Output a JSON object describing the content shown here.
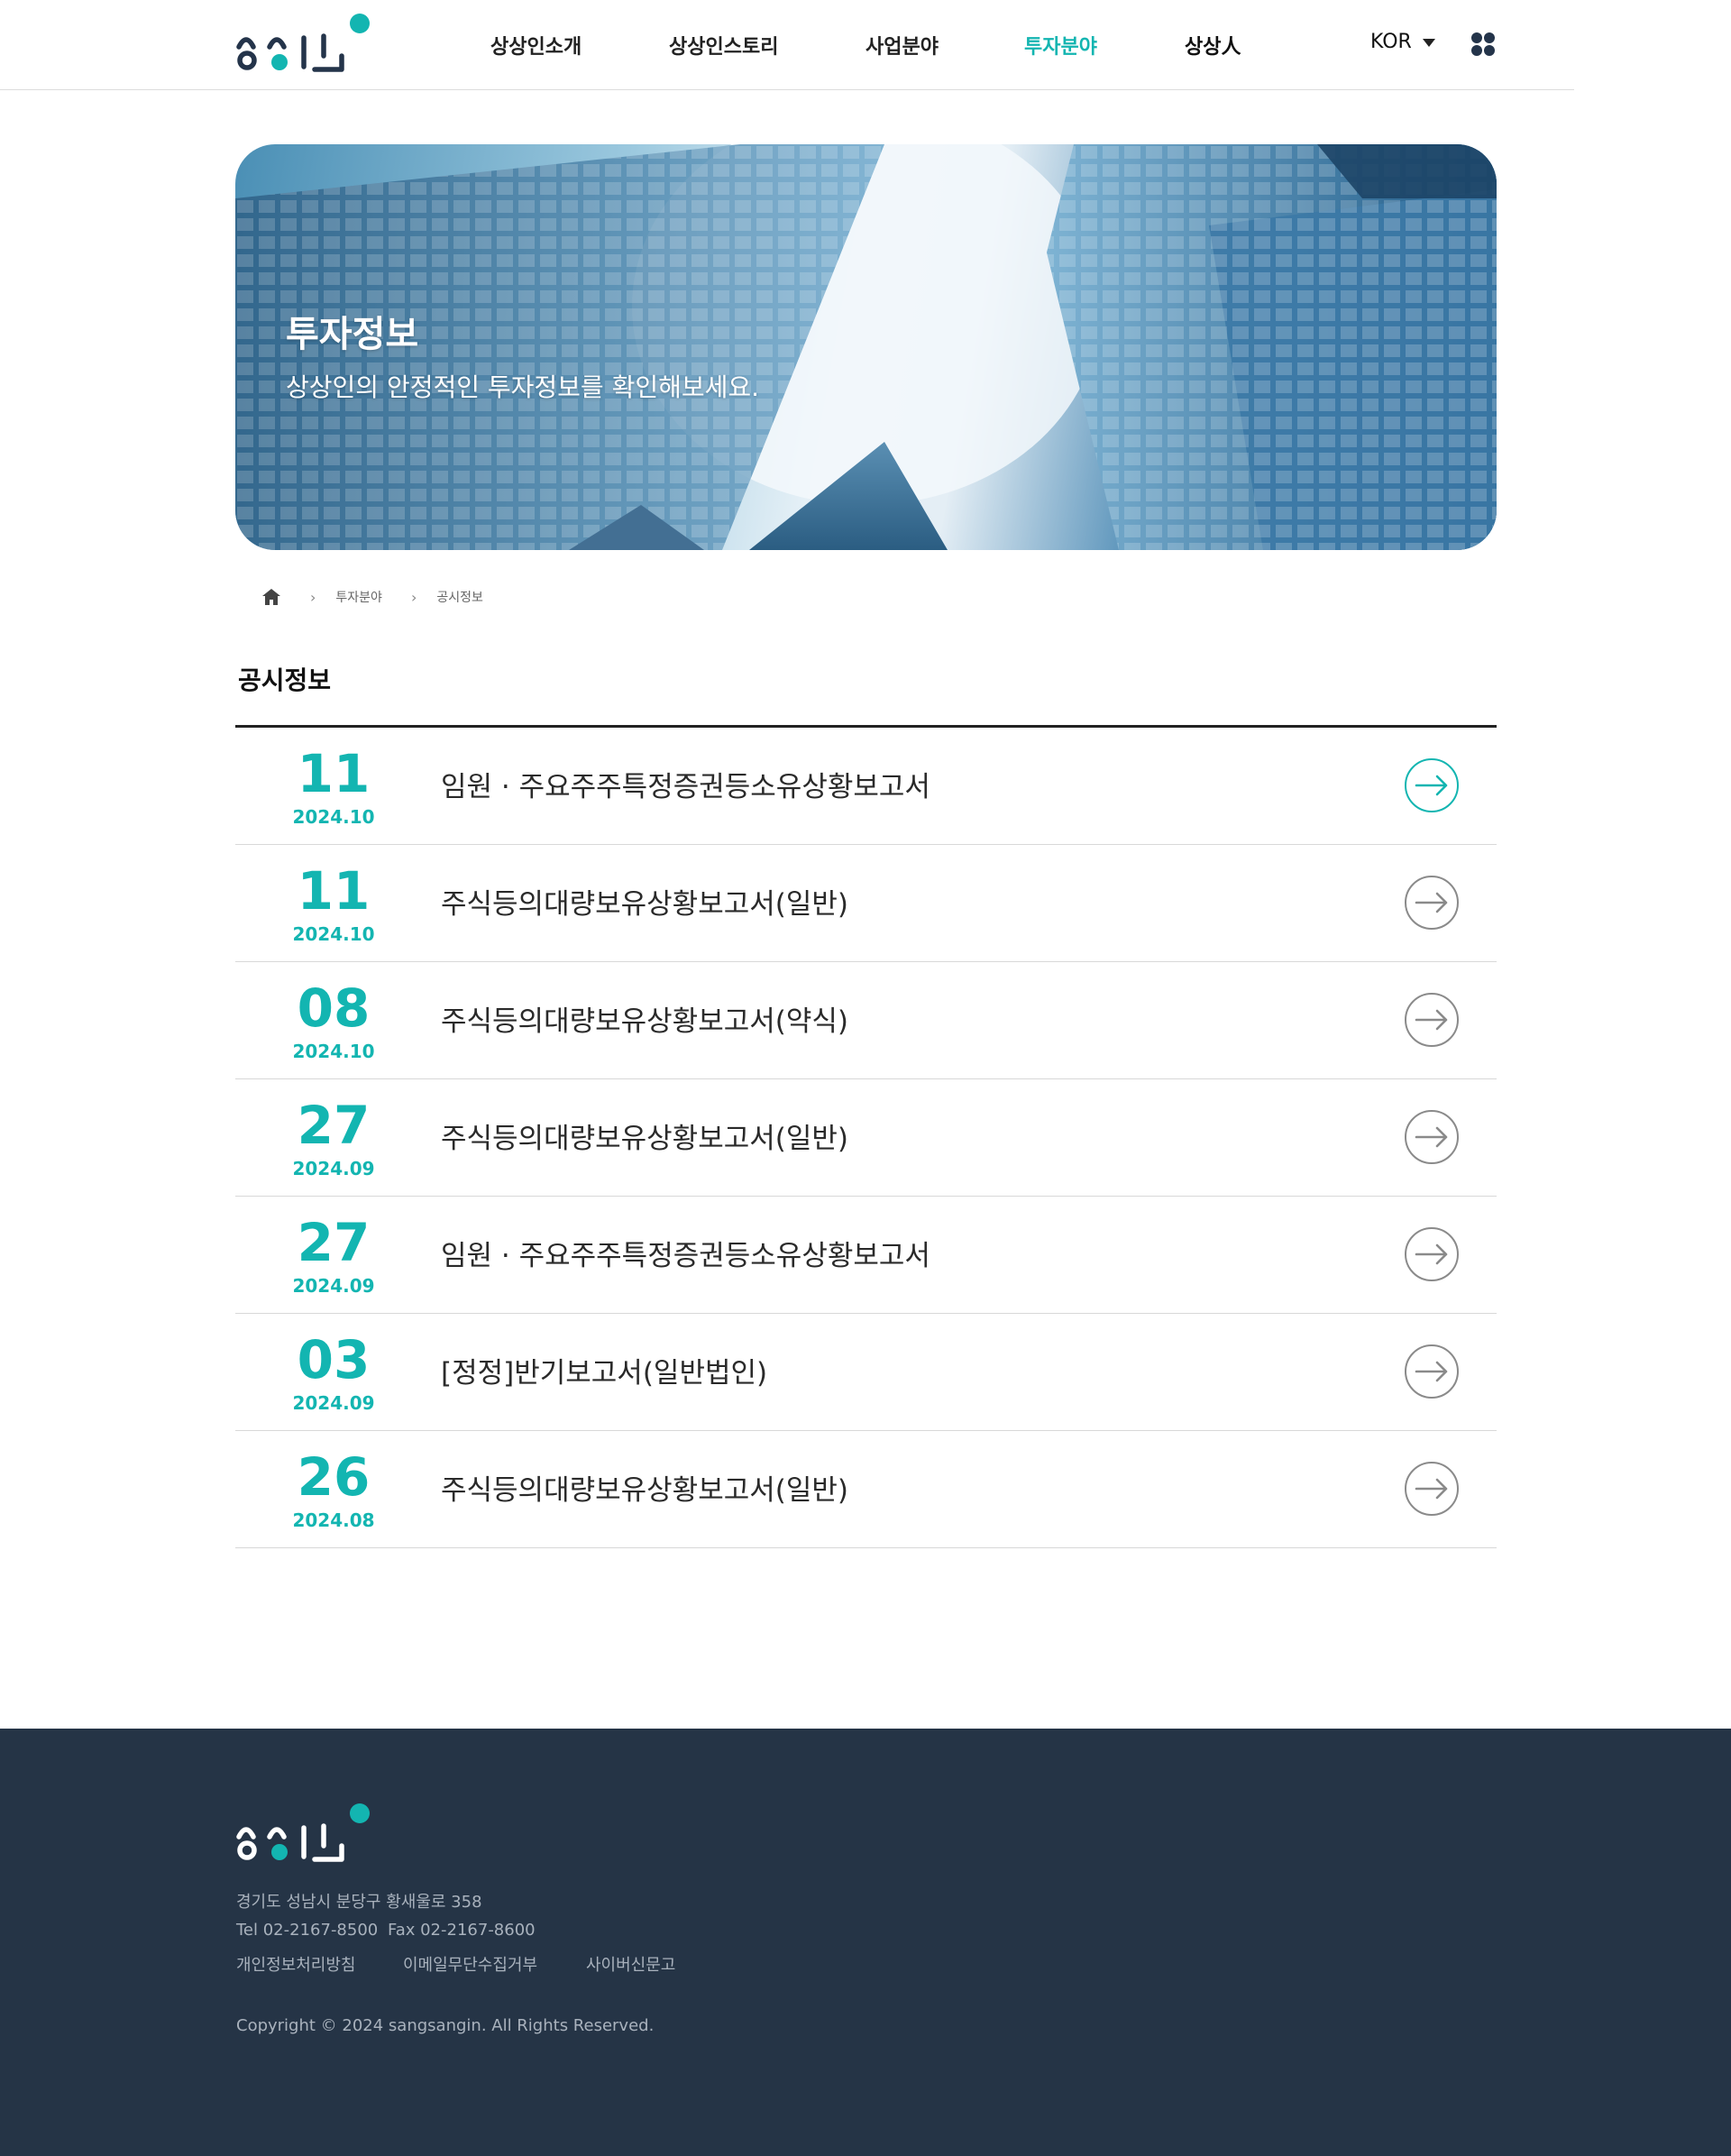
{
  "header": {
    "logo_text": "상상인",
    "nav": [
      {
        "label": "상상인소개"
      },
      {
        "label": "상상인스토리"
      },
      {
        "label": "사업분야"
      },
      {
        "label": "투자분야"
      },
      {
        "label": "상상人"
      }
    ],
    "active_nav": "투자분야",
    "language": "KOR",
    "menu_icon": "grid-dots-icon"
  },
  "hero": {
    "title": "투자정보",
    "subtitle": "상상인의 안정적인 투자정보를 확인해보세요."
  },
  "breadcrumb": {
    "home_icon": "home-icon",
    "items": [
      "투자분야",
      "공시정보"
    ]
  },
  "section": {
    "title": "공시정보"
  },
  "disclosures": [
    {
      "day": "11",
      "ym": "2024.10",
      "subject": "임원 · 주요주주특정증권등소유상황보고서",
      "active": true
    },
    {
      "day": "11",
      "ym": "2024.10",
      "subject": "주식등의대량보유상황보고서(일반)",
      "active": false
    },
    {
      "day": "08",
      "ym": "2024.10",
      "subject": "주식등의대량보유상황보고서(약식)",
      "active": false
    },
    {
      "day": "27",
      "ym": "2024.09",
      "subject": "주식등의대량보유상황보고서(일반)",
      "active": false
    },
    {
      "day": "27",
      "ym": "2024.09",
      "subject": "임원 · 주요주주특정증권등소유상황보고서",
      "active": false
    },
    {
      "day": "03",
      "ym": "2024.09",
      "subject": "[정정]반기보고서(일반법인)",
      "active": false
    },
    {
      "day": "26",
      "ym": "2024.08",
      "subject": "주식등의대량보유상황보고서(일반)",
      "active": false
    }
  ],
  "footer": {
    "address": "경기도 성남시 분당구 황새울로 358",
    "tel": "Tel 02-2167-8500",
    "fax": "Fax 02-2167-8600",
    "links": [
      "개인정보처리방침",
      "이메일무단수집거부",
      "사이버신문고"
    ],
    "copyright": "Copyright © 2024 sangsangin. All Rights Reserved."
  },
  "colors": {
    "accent": "#13b5b1",
    "navy": "#253446",
    "text": "#222222"
  }
}
